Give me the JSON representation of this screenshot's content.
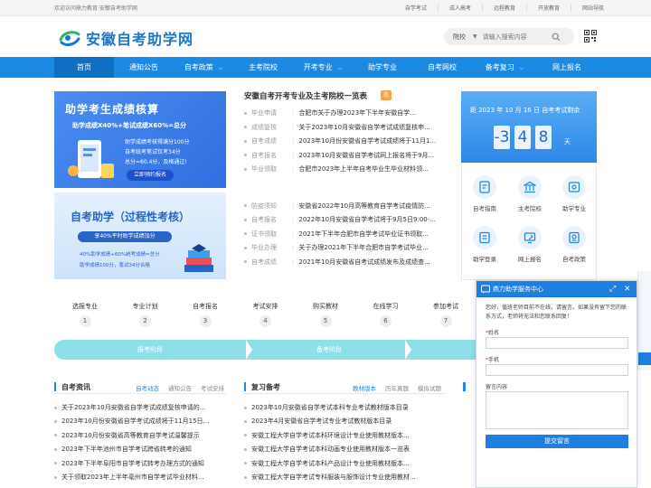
{
  "topbar": {
    "welcome": "欢迎访问鼎力教育·安徽自考助学网",
    "links": [
      "自学考试",
      "成人高考",
      "远程教育",
      "开放教育",
      "网站导航"
    ]
  },
  "header": {
    "logo_text": "安徽自考助学网",
    "search": {
      "category": "院校",
      "placeholder": "请输入搜索内容"
    }
  },
  "nav": {
    "items": [
      {
        "label": "首页",
        "dropdown": false
      },
      {
        "label": "通知公告",
        "dropdown": false
      },
      {
        "label": "自考政策",
        "dropdown": true
      },
      {
        "label": "主考院校",
        "dropdown": false
      },
      {
        "label": "开考专业",
        "dropdown": true
      },
      {
        "label": "助学专业",
        "dropdown": false
      },
      {
        "label": "自考网校",
        "dropdown": false
      },
      {
        "label": "备考复习",
        "dropdown": true
      },
      {
        "label": "网上报名",
        "dropdown": false
      }
    ]
  },
  "banner1": {
    "title": "助学考生成绩核算",
    "subtitle": "助学成绩X40%+笔试成绩X60%=总分",
    "lines": [
      "助学成绩考核得满分100分",
      "自考统考笔试仅考34分",
      "总分=60.4分，及格通过!"
    ],
    "button": "立即预约报名"
  },
  "banner2": {
    "title": "自考助学（过程性考核）",
    "pill": "享40%平时助学成绩加分",
    "lines": [
      "40%助学成绩+60%统考成绩=总分",
      "助学成绩100分，笔试34分合格"
    ]
  },
  "news": {
    "title": "安徽自考开考专业及主考院校一览表",
    "badge": "热",
    "rows": [
      {
        "cat": "毕业申请",
        "text": "合肥市关于办理2023年下半年安徽自学..."
      },
      {
        "cat": "成绩复核",
        "text": "关于2023年10月安徽省自学考试成绩复核申..."
      },
      {
        "cat": "自考成绩",
        "text": "2023年10月份安徽省自学考试成绩将于11月1..."
      },
      {
        "cat": "自考报名",
        "text": "2023年10月安徽省自学考试网上报名将于9月..."
      },
      {
        "cat": "毕业领取",
        "text": "合肥市2023年上半年自考毕业生毕业材料领..."
      },
      {
        "cat": "防疫须知",
        "text": "安徽省2022年10月高等教育自学考试疫情防..."
      },
      {
        "cat": "自考报名",
        "text": "2022年10月安徽省自学考试将于9月5日9:00-..."
      },
      {
        "cat": "证书领取",
        "text": "2021年下半年合肥市自学考试毕业证书领取..."
      },
      {
        "cat": "毕业办理",
        "text": "关于办理2021年下半年合肥市自学考试毕业..."
      },
      {
        "cat": "自考成绩",
        "text": "2021年10月安徽省自考试成绩发布及成绩查..."
      }
    ]
  },
  "countdown": {
    "title": "距 2023 年 10 月 16 日 自考考试剩余",
    "digits": [
      "-3",
      "4",
      "8"
    ],
    "unit": "天"
  },
  "quicklinks": [
    {
      "label": "自考指南",
      "icon": "guide-icon"
    },
    {
      "label": "主考院校",
      "icon": "school-icon"
    },
    {
      "label": "助学专业",
      "icon": "major-icon"
    },
    {
      "label": "助学登录",
      "icon": "login-icon"
    },
    {
      "label": "网上报名",
      "icon": "register-icon"
    },
    {
      "label": "自考政策",
      "icon": "policy-icon"
    }
  ],
  "steps": {
    "items": [
      {
        "label": "选报专业",
        "num": "1"
      },
      {
        "label": "专业计划",
        "num": "2"
      },
      {
        "label": "自考报名",
        "num": "3"
      },
      {
        "label": "考试安排",
        "num": "4"
      },
      {
        "label": "购买教材",
        "num": "5"
      },
      {
        "label": "在线学习",
        "num": "6"
      },
      {
        "label": "参加考试",
        "num": "7"
      }
    ],
    "phases": [
      "报考阶段",
      "备考阶段"
    ]
  },
  "col1": {
    "title": "自考资讯",
    "tabs": [
      "自考动态",
      "通知公告",
      "考试安排"
    ],
    "rows": [
      "关于2023年10月安徽省自学考试成绩复核申请的...",
      "2023年10月份安徽省自学考试成绩将于11月15日...",
      "2023年10月份安徽省高等教育自学考试温馨提示",
      "2023年下半年池州市自学考试跨省转考的通知",
      "2023年下半年阜阳市自学考试转考办理方式的通知",
      "关于领取2023年上半年亳州市自学考试毕业材料..."
    ]
  },
  "col2": {
    "title": "复习备考",
    "tabs": [
      "教材版本",
      "历年真题",
      "模拟试题"
    ],
    "rows": [
      "2023年10月安徽省自学考试本科专业考试教材版本目录",
      "2023年4月安徽省自学考试专业考试教材版本目录",
      "安徽工程大学自学考试本科环境设计专业使用教材版本...",
      "安徽工程大学自学考试本科动画专业使用教材版本一览表",
      "安徽工程大学自学考试本科产品设计专业使用教材版本...",
      "安徽工程大学自学考试专科服装与服饰设计专业使用教材..."
    ]
  },
  "chat": {
    "title": "鼎力助学服务中心",
    "intro": "您好，值班老师目前不在线，请留言。如果没有留下您的联系方式，老师将无法和您联系回复！",
    "fields": [
      {
        "label": "姓名",
        "required": true
      },
      {
        "label": "手机",
        "required": true
      },
      {
        "label": "留言内容",
        "required": false
      }
    ],
    "submit": "提交留言"
  },
  "colors": {
    "brand": "#1a8ae5",
    "nav_active": "#0f6fc2",
    "phase": "#8ddfe8"
  }
}
